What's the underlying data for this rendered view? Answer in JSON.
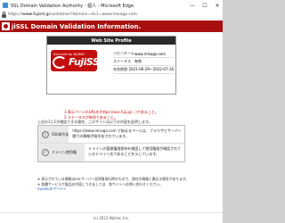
{
  "window": {
    "title": "SSL Domain Validation Authority - 個人 - Microsoft Edge",
    "controls": [
      "—",
      "☐",
      "✕"
    ]
  },
  "addressbar": {
    "scheme": "https://",
    "host": "www.fujissl.jp",
    "path": "/validation?domain=dv1=www.misago.com"
  },
  "banner": {
    "text": "jiSSL Domain Validation Information."
  },
  "profile": {
    "heading": "Web Site Profile",
    "seal_top": "Secured by NIJIMO",
    "seal_main": "FujiSSL",
    "rows": [
      {
        "label": "コモンネーム",
        "value": "www.misago.com"
      },
      {
        "label": "ステータス",
        "value": "有効"
      },
      {
        "label": "有効期間",
        "value": "2021-06-29～2022-07-16"
      }
    ]
  },
  "notes": [
    "1.表示ページのURLを(https://xxx.fuji.jp/...)であること。",
    "2.ステータスが有効であること。"
  ],
  "lead_text": "上記の1と2が確認できる場合、このサイトは以下の内容を証明します。",
  "info_rows": [
    {
      "icon": "ⓘ",
      "label": "SSL暗号化",
      "lines": [
        "https://www.misago.com で始まるページは、ブラウザとサーバー",
        "間での情報が暗号化されています。"
      ]
    },
    {
      "icon": "✓",
      "label": "ドメイン使用権",
      "lines": [
        "ドメインの管理権限保持を確認して使用権限が確認されて",
        "いるドメイン名であることを示しています。"
      ]
    }
  ],
  "footnotes": [
    "※ 表示されている情報はSSLサーバー証明書発行時のもので、現在の情報と異なる場合があります。",
    "※ 各種サービスや製品の内容につきましては、各サイトへお問い合わせください。",
    "FujiSSLのページへ"
  ],
  "footer": {
    "text": "(c) 2021 Nijimo, Inc."
  }
}
